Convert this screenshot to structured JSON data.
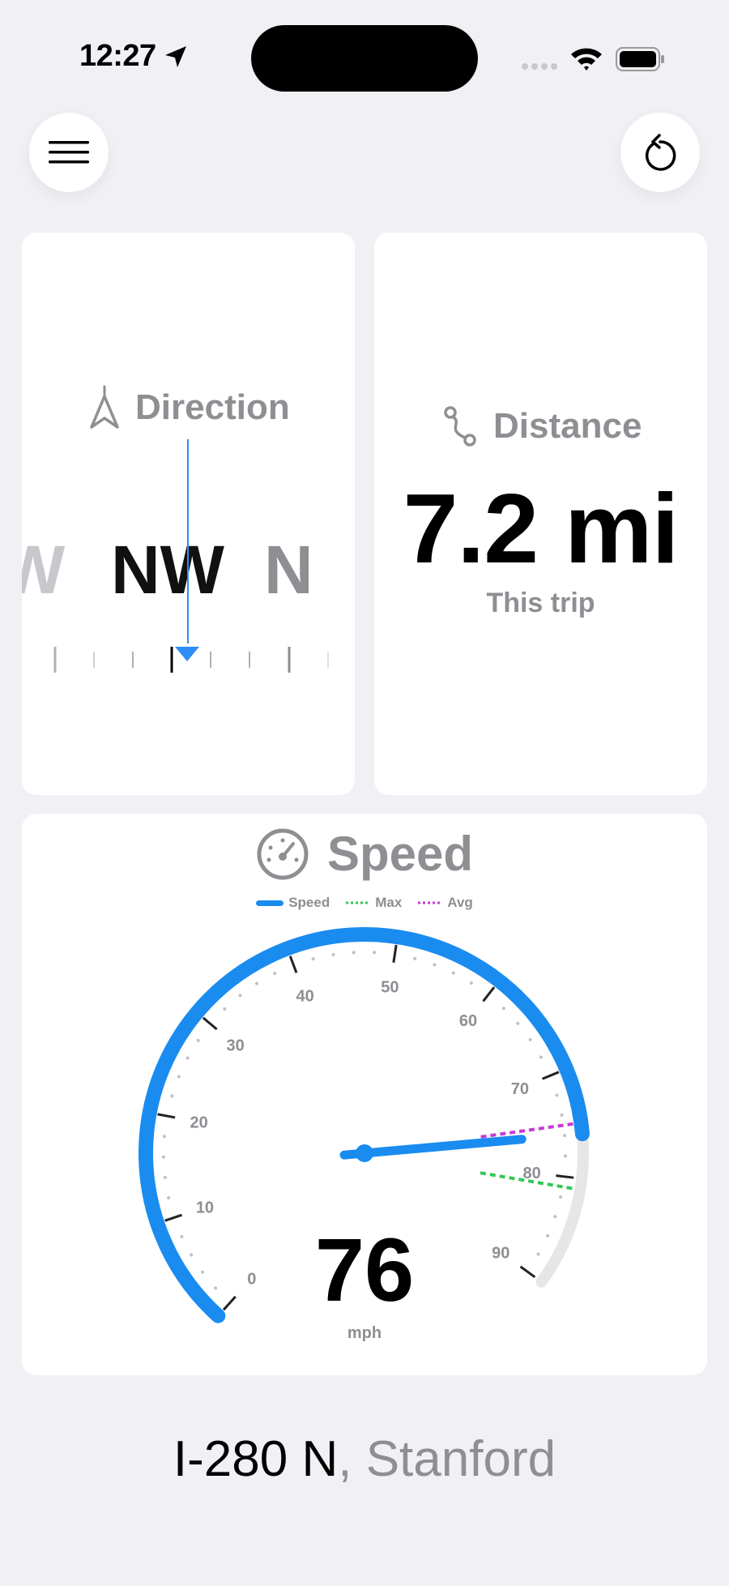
{
  "status_bar": {
    "time": "12:27",
    "icons": [
      "location-arrow-icon",
      "signal-dots-icon",
      "wifi-icon",
      "battery-icon"
    ]
  },
  "toolbar": {
    "menu_icon": "hamburger-menu-icon",
    "reset_icon": "counterclockwise-reset-icon"
  },
  "direction": {
    "title": "Direction",
    "icon": "navigation-arrow-icon",
    "letters": [
      "W",
      "NW",
      "N"
    ],
    "current": "NW",
    "accent": "#2f8ef5"
  },
  "distance": {
    "title": "Distance",
    "icon": "route-icon",
    "value": "7.2 mi",
    "subtitle": "This trip"
  },
  "speed": {
    "title": "Speed",
    "icon": "speedometer-icon",
    "legend": [
      {
        "label": "Speed",
        "color": "#1a8cf0"
      },
      {
        "label": "Max",
        "color": "#34c759"
      },
      {
        "label": "Avg",
        "color": "#c63bd6"
      }
    ],
    "value": "76",
    "unit": "mph",
    "current": 76,
    "max": 81,
    "avg": 75,
    "scale_min": 0,
    "scale_max": 90,
    "scale_labels": [
      "0",
      "10",
      "20",
      "30",
      "40",
      "50",
      "60",
      "70",
      "80",
      "90"
    ],
    "colors": {
      "arc": "#1a8cf0",
      "track": "#e6e6e6"
    }
  },
  "location": {
    "road": "I-280 N",
    "city": ", Stanford"
  }
}
